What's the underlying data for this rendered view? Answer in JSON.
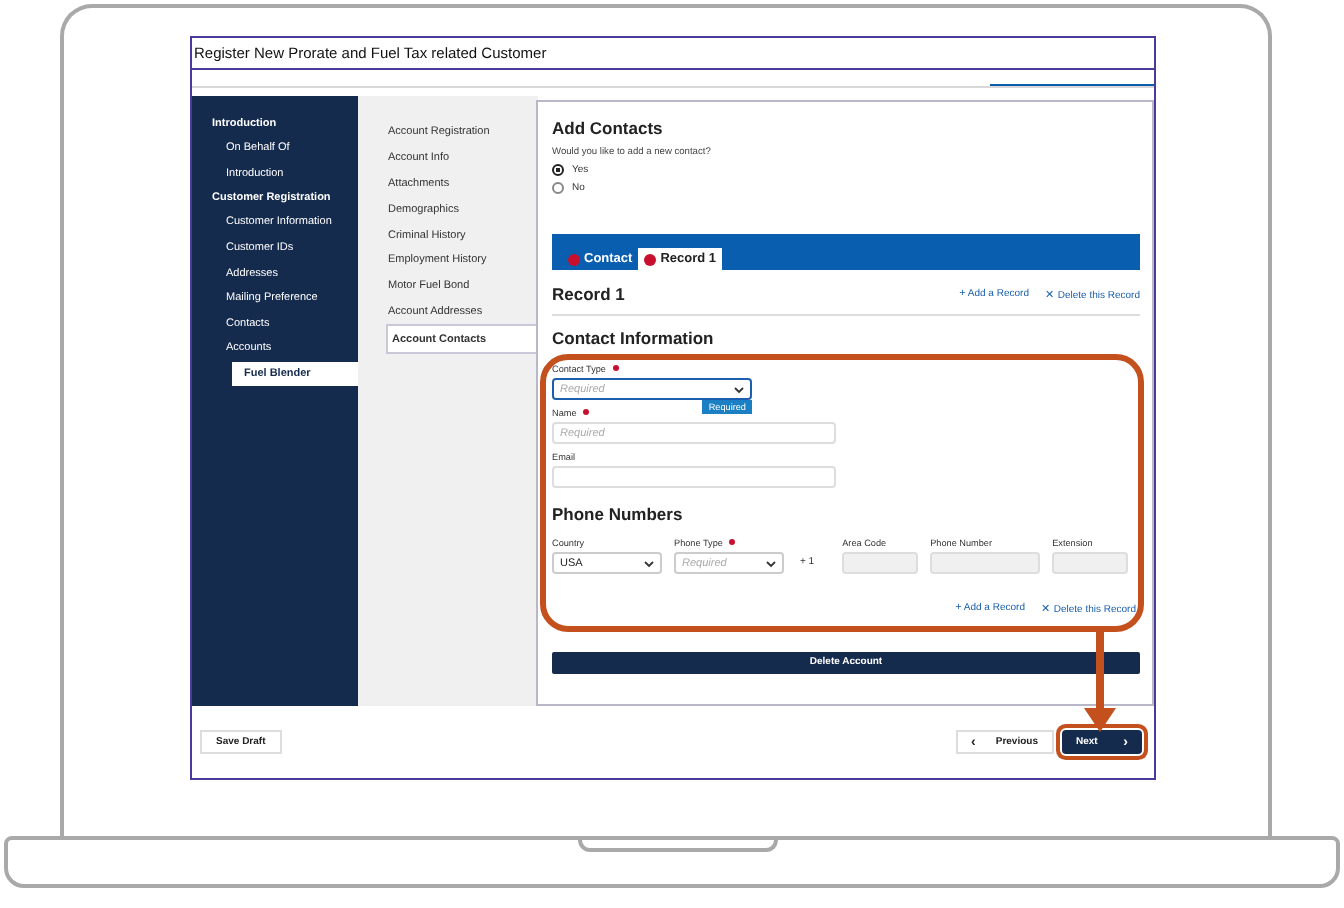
{
  "window": {
    "title": "Register New Prorate and Fuel Tax related Customer"
  },
  "sidebar": {
    "sections": [
      {
        "label": "Introduction",
        "children": [
          {
            "label": "On Behalf Of",
            "selected": false
          },
          {
            "label": "Introduction",
            "selected": false
          }
        ]
      },
      {
        "label": "Customer Registration",
        "children": [
          {
            "label": "Customer Information",
            "selected": false
          },
          {
            "label": "Customer IDs",
            "selected": false
          },
          {
            "label": "Addresses",
            "selected": false
          },
          {
            "label": "Mailing Preference",
            "selected": false
          },
          {
            "label": "Contacts",
            "selected": false
          },
          {
            "label": "Accounts",
            "selected": false,
            "children": [
              {
                "label": "Fuel Blender",
                "selected": true
              }
            ]
          }
        ]
      }
    ]
  },
  "subnav": {
    "items": [
      {
        "label": "Account Registration",
        "selected": false
      },
      {
        "label": "Account Info",
        "selected": false
      },
      {
        "label": "Attachments",
        "selected": false
      },
      {
        "label": "Demographics",
        "selected": false
      },
      {
        "label": "Criminal History",
        "selected": false
      },
      {
        "label": "Employment History",
        "selected": false
      },
      {
        "label": "Motor Fuel Bond",
        "selected": false
      },
      {
        "label": "Account Addresses",
        "selected": false
      },
      {
        "label": "Account Contacts",
        "selected": true
      }
    ]
  },
  "content": {
    "heading": "Add Contacts",
    "question": "Would you like to add a new contact?",
    "options": [
      {
        "label": "Yes",
        "selected": true
      },
      {
        "label": "No",
        "selected": false
      }
    ],
    "tabs": [
      {
        "label": "Contact",
        "selected": false,
        "error": true
      },
      {
        "label": "Record 1",
        "selected": true,
        "error": true
      }
    ],
    "record_title": "Record 1",
    "actions": [
      {
        "icon": "+",
        "label": "Add a Record"
      },
      {
        "icon": "✕",
        "label": "Delete this Record"
      }
    ],
    "contact_heading": "Contact Information",
    "fields": [
      {
        "kind": "select",
        "label": "Contact Type",
        "required": true,
        "placeholder": "Required",
        "tooltip": "Required"
      },
      {
        "kind": "input",
        "label": "Name",
        "required": true,
        "placeholder": "Required"
      },
      {
        "kind": "input",
        "label": "Email",
        "required": false
      }
    ],
    "phone_heading": "Phone Numbers",
    "phone_fields": [
      {
        "kind": "select",
        "label": "Country",
        "required": false,
        "value": "USA"
      },
      {
        "kind": "select",
        "label": "Phone Type",
        "required": true,
        "placeholder": "Required"
      },
      {
        "kind": "text",
        "value": "+ 1"
      },
      {
        "kind": "input",
        "label": "Area Code",
        "required": false,
        "disabled": true
      },
      {
        "kind": "input",
        "label": "Phone Number",
        "required": false,
        "disabled": true
      },
      {
        "kind": "input",
        "label": "Extension",
        "required": false,
        "disabled": true
      }
    ],
    "bottom_actions": [
      {
        "icon": "+",
        "label": "Add a Record"
      },
      {
        "icon": "✕",
        "label": "Delete this Record"
      }
    ],
    "delete_button": "Delete Account"
  },
  "footer": {
    "save": "Save Draft",
    "previous": {
      "icon": "‹",
      "label": "Previous"
    },
    "next": {
      "label": "Next",
      "icon": "›",
      "highlighted": true
    }
  }
}
